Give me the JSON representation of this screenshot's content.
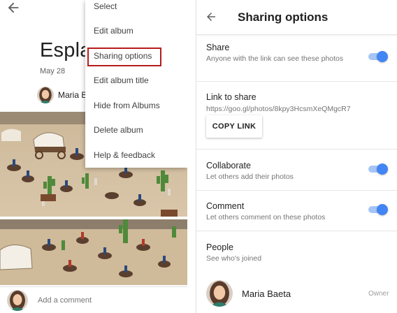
{
  "left": {
    "album_title": "Esplay",
    "album_date": "May 28",
    "owner_name": "Maria Baeta",
    "comment_placeholder": "Add a comment"
  },
  "menu": {
    "items": [
      "Select",
      "Edit album",
      "Sharing options",
      "Edit album title",
      "Hide from Albums",
      "Delete album",
      "Help & feedback"
    ],
    "highlighted_index": 2
  },
  "sharing": {
    "title": "Sharing options",
    "share": {
      "label": "Share",
      "description": "Anyone with the link can see these photos",
      "enabled": true
    },
    "link": {
      "label": "Link to share",
      "url": "https://goo.gl/photos/8kpy3HcsmXeQMgcR7",
      "copy_label": "COPY LINK"
    },
    "collaborate": {
      "label": "Collaborate",
      "description": "Let others add their photos",
      "enabled": true
    },
    "comment": {
      "label": "Comment",
      "description": "Let others comment on these photos",
      "enabled": true
    },
    "people": {
      "label": "People",
      "description": "See who's joined",
      "members": [
        {
          "name": "Maria Baeta",
          "role": "Owner"
        }
      ]
    }
  },
  "colors": {
    "accent": "#4285f4",
    "highlight_box": "#b71c1c"
  },
  "icons": {
    "back": "arrow-back-icon"
  }
}
